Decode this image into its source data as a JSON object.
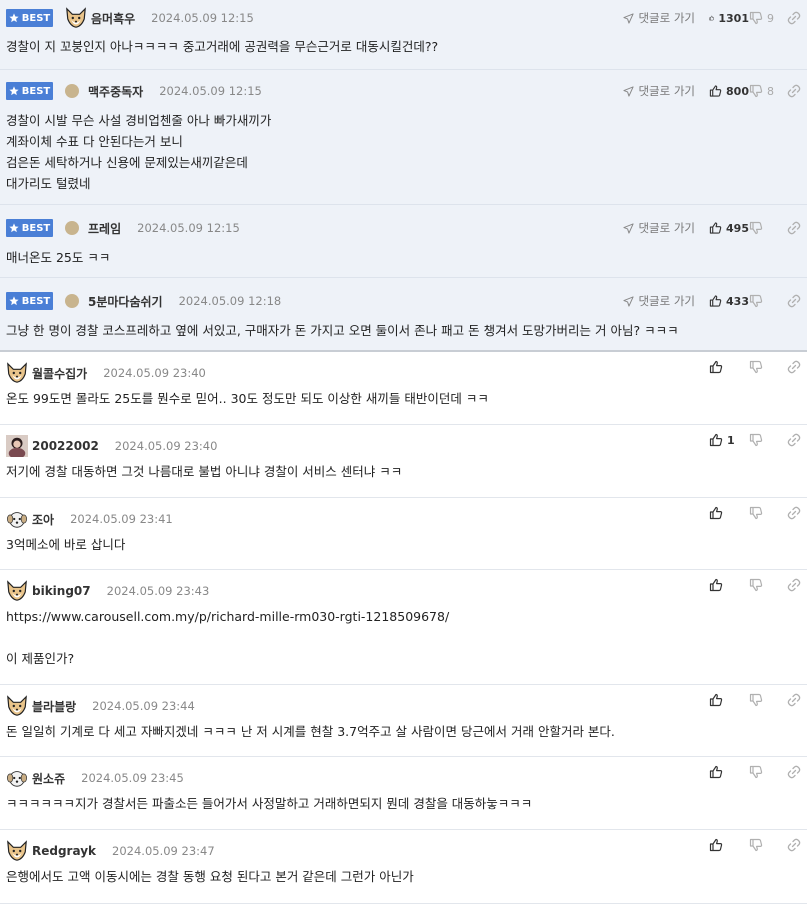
{
  "best_badge_label": "BEST",
  "reply_label": "댓글로 가기",
  "comments": [
    {
      "nick": "음머흑우",
      "date": "2024.05.09 12:15",
      "up": "1301",
      "down": "9",
      "lines": [
        "경찰이 지 꼬붕인지 아나ㅋㅋㅋㅋ 중고거래에 공권력을 무슨근거로 대동시킬건데??"
      ]
    },
    {
      "nick": "맥주중독자",
      "date": "2024.05.09 12:15",
      "up": "800",
      "down": "8",
      "lines": [
        "경찰이 시발 무슨 사설 경비업첸줄 아나 빠가새끼가",
        "계좌이체 수표 다 안된다는거 보니",
        "검은돈 세탁하거나 신용에 문제있는새끼같은데",
        "대가리도 털렸네"
      ]
    },
    {
      "nick": "프레임",
      "date": "2024.05.09 12:15",
      "up": "495",
      "down": "",
      "lines": [
        "매너온도 25도 ㅋㅋ"
      ]
    },
    {
      "nick": "5분마다숨쉬기",
      "date": "2024.05.09 12:18",
      "up": "433",
      "down": "",
      "lines": [
        "그냥 한 명이 경찰 코스프레하고 옆에 서있고, 구매자가 돈 가지고 오면 둘이서 존나 패고 돈 챙겨서 도망가버리는 거 아님? ㅋㅋㅋ"
      ]
    },
    {
      "nick": "월콜수집가",
      "date": "2024.05.09 23:40",
      "up": "",
      "lines": [
        "온도 99도면 몰라도 25도를 뭔수로 믿어.. 30도 정도만 되도 이상한 새끼들 태반이던데 ㅋㅋ"
      ]
    },
    {
      "nick": "20022002",
      "date": "2024.05.09 23:40",
      "up": "1",
      "lines": [
        "저기에 경찰 대동하면 그것 나름대로 불법 아니냐 경찰이 서비스 센터냐 ㅋㅋ"
      ]
    },
    {
      "nick": "조아",
      "date": "2024.05.09 23:41",
      "up": "",
      "lines": [
        "3억메소에 바로 삽니다"
      ]
    },
    {
      "nick": "biking07",
      "date": "2024.05.09 23:43",
      "up": "",
      "lines": [
        "https://www.carousell.com.my/p/richard-mille-rm030-rgti-1218509678/",
        "",
        "이 제품인가?"
      ]
    },
    {
      "nick": "블라블랑",
      "date": "2024.05.09 23:44",
      "up": "",
      "lines": [
        "돈 일일히 기계로 다 세고 자빠지겠네 ㅋㅋㅋ 난 저 시계를 현찰 3.7억주고 살 사람이면 당근에서 거래 안할거라 본다."
      ]
    },
    {
      "nick": "원소쥬",
      "date": "2024.05.09 23:45",
      "up": "",
      "lines": [
        "ㅋㅋㅋㅋㅋㅋ지가 경찰서든 파출소든 들어가서 사정말하고 거래하면되지 뭔데 경찰을 대동하눟ㅋㅋㅋ"
      ]
    },
    {
      "nick": "Redgrayk",
      "date": "2024.05.09 23:47",
      "up": "",
      "lines": [
        "은행에서도 고액 이동시에는 경찰 동행 요청 된다고 본거 같은데 그런가 아닌가"
      ]
    }
  ]
}
